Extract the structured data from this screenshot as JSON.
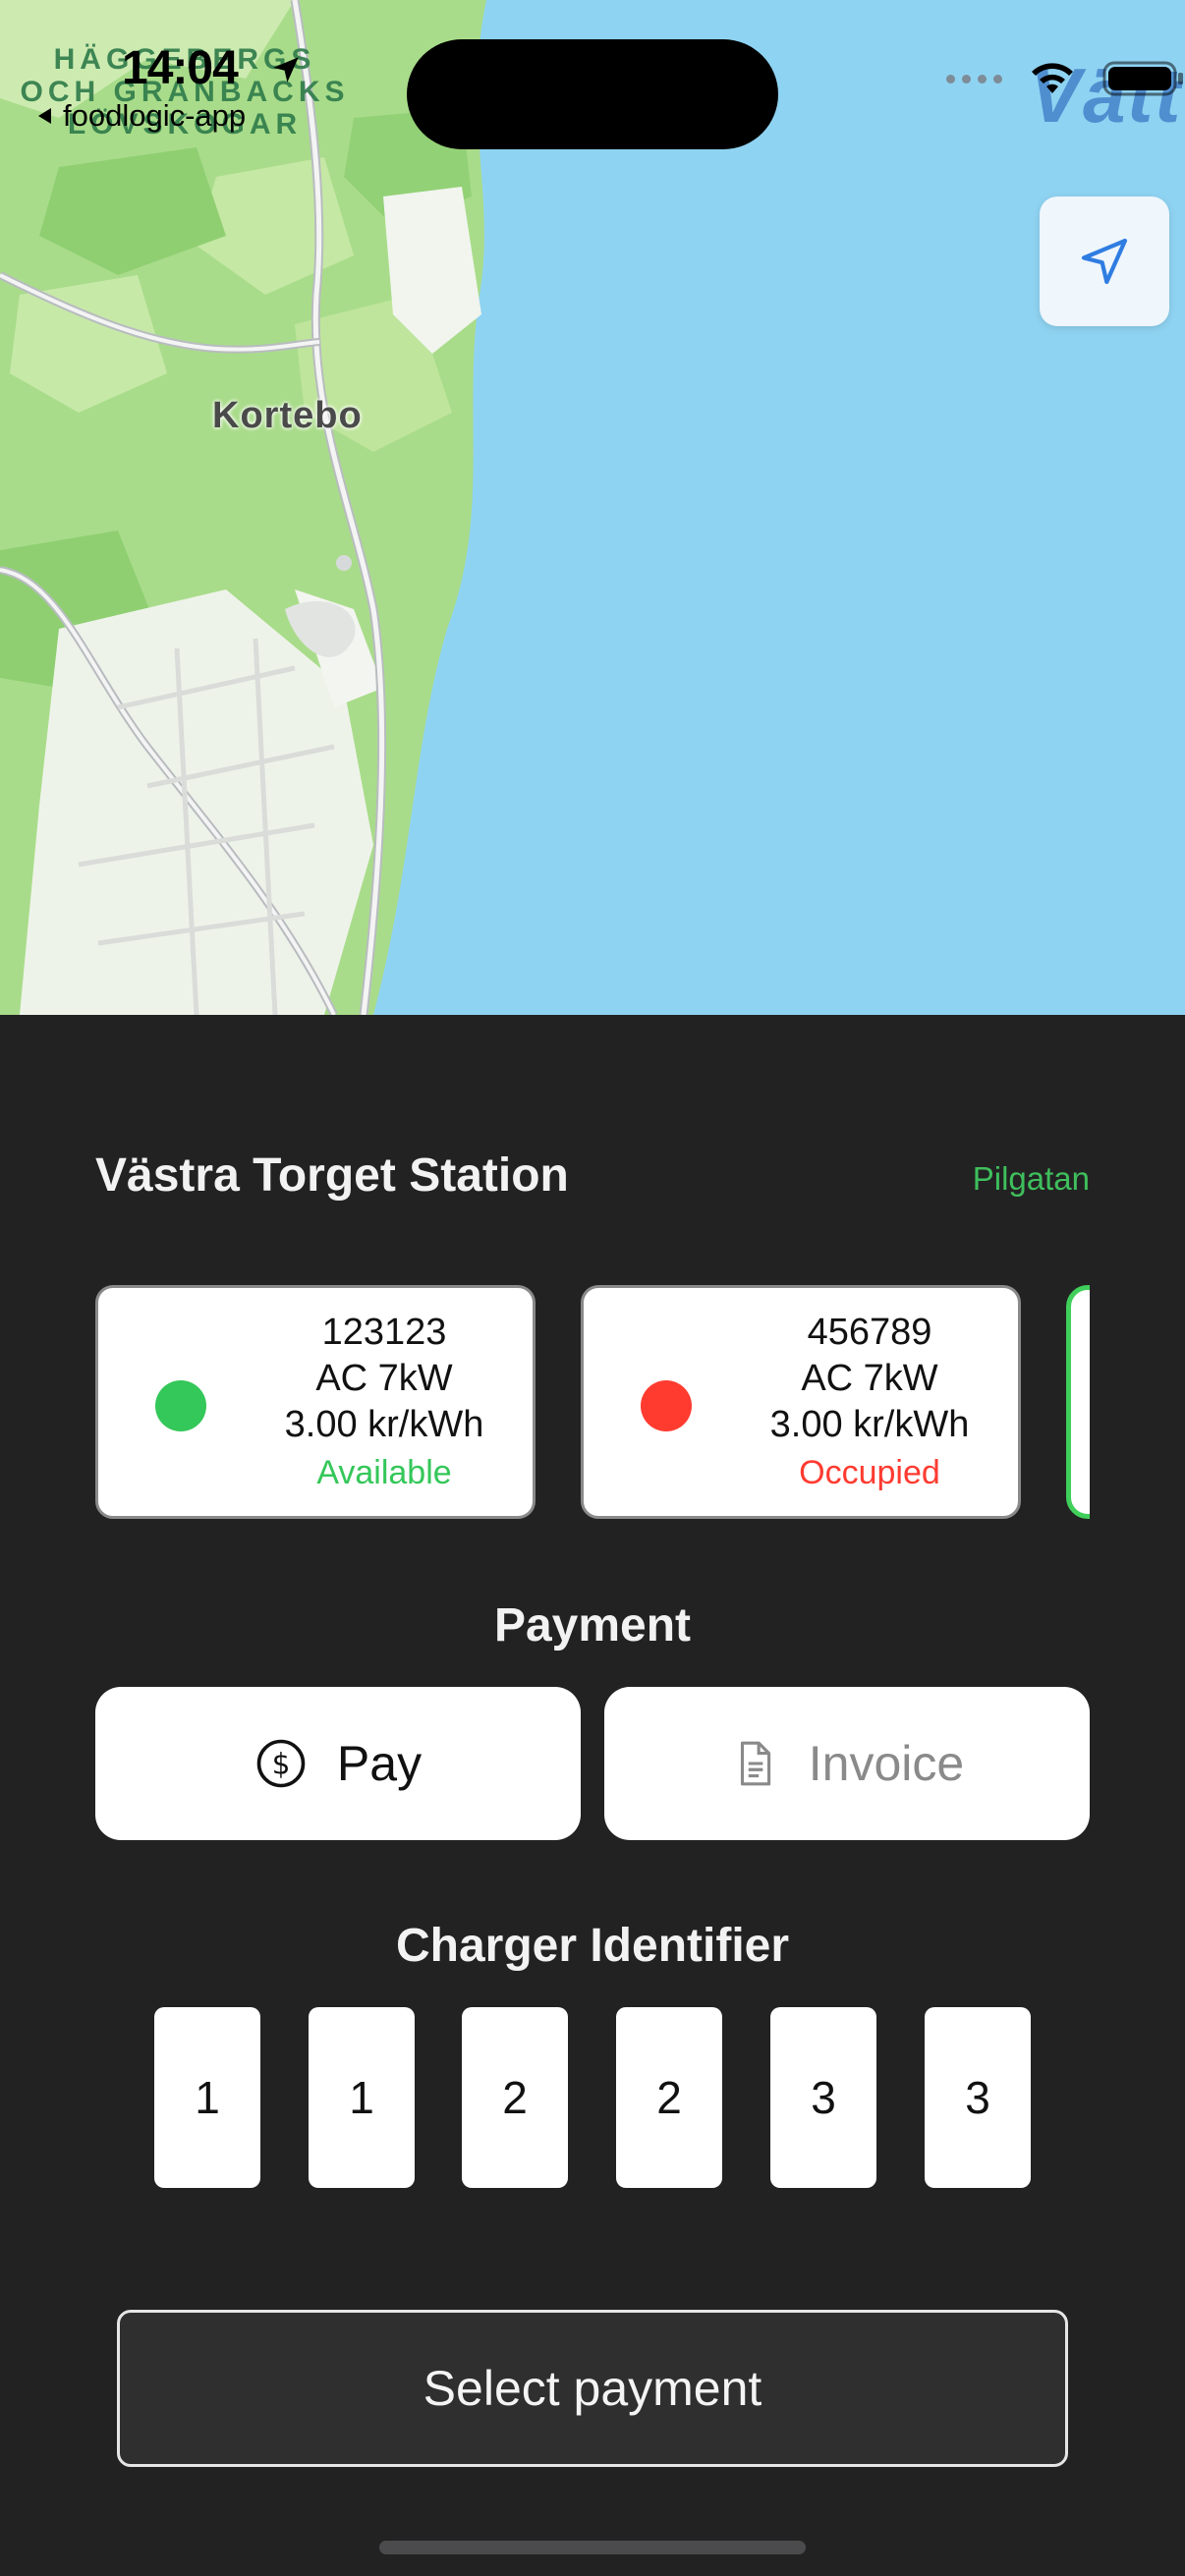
{
  "status_bar": {
    "time": "14:04",
    "back_label": "foodlogic-app"
  },
  "map": {
    "area_label_lines": [
      "HÄGGEBERGS",
      "OCH GRANBACKS",
      "LÖVSKOGAR"
    ],
    "place_label": "Kortebo",
    "lake_label": "Vätt",
    "colors": {
      "water": "#8fd3f2",
      "forest": "#a9dc8a",
      "land": "#e8f3d8"
    }
  },
  "station": {
    "name": "Västra Torget Station",
    "street": "Pilgatan"
  },
  "chargers": [
    {
      "id": "123123",
      "type": "AC 7kW",
      "price": "3.00 kr/kWh",
      "status": "Available",
      "status_color": "#34c759"
    },
    {
      "id": "456789",
      "type": "AC 7kW",
      "price": "3.00 kr/kWh",
      "status": "Occupied",
      "status_color": "#ff3b30"
    }
  ],
  "payment": {
    "title": "Payment",
    "pay_label": "Pay",
    "invoice_label": "Invoice"
  },
  "identifier": {
    "title": "Charger Identifier",
    "digits": [
      "1",
      "1",
      "2",
      "2",
      "3",
      "3"
    ]
  },
  "select_payment_label": "Select payment"
}
